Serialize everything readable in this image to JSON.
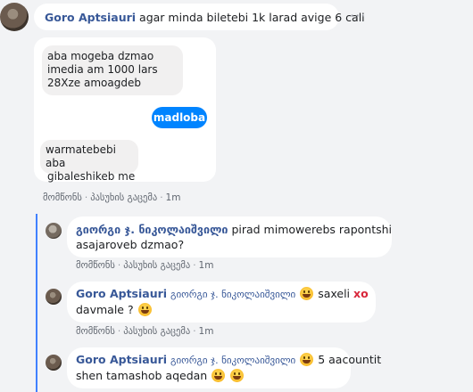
{
  "top_comment": {
    "author": "Goro Aptsiauri",
    "text": "agar minda biletebi 1k larad avige 6 cali",
    "more_label": "···"
  },
  "screenshot": {
    "msg1_l1": "aba mogeba dzmao",
    "msg1_l2": "imedia  am 1000 lars",
    "msg1_l3": "28Xze amoagdeb",
    "reply": "madloba",
    "msg2_l1": "warmatebebi aba",
    "msg2_l2": "gibaleshikeb me"
  },
  "top_actions": {
    "like": "მომწონს",
    "reply": "პასუხის გაცემა",
    "time": "1m"
  },
  "replies": [
    {
      "author": "გიორგი ჯ. ნიკოლაიშვილი",
      "text_l1": "pirad mimowerebs rapontshi",
      "text_l2": "asajaroveb dzmao?",
      "like": "მომწონს",
      "reply": "პასუხის გაცემა",
      "time": "1m"
    },
    {
      "author": "Goro Aptsiauri",
      "mention": "გიორგი ჯ. ნიკოლაიშვილი",
      "text_a": "saxeli",
      "text_xo": "xo",
      "text_l2": "davmale ?",
      "like": "მომწონს",
      "reply": "პასუხის გაცემა",
      "time": "1m"
    },
    {
      "author": "Goro Aptsiauri",
      "mention": "გიორგი ჯ. ნიკოლაიშვილი",
      "text_a": "5 aacountit",
      "text_l2": "shen tamashob aqedan"
    }
  ],
  "colors": {
    "name": "#385898",
    "accent": "#0084ff",
    "thread": "#4080ff",
    "xo": "#d8263a"
  }
}
